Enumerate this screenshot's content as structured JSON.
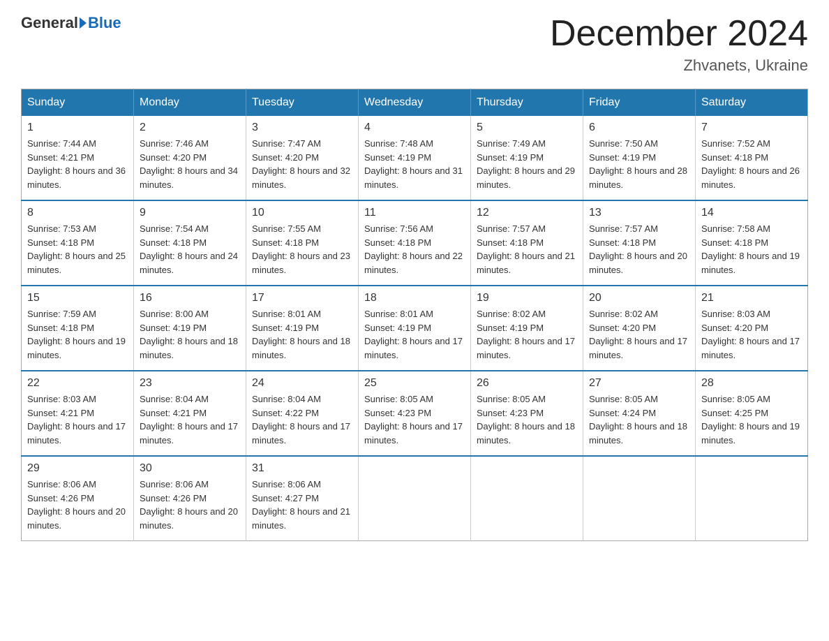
{
  "header": {
    "logo_general": "General",
    "logo_blue": "Blue",
    "month_title": "December 2024",
    "location": "Zhvanets, Ukraine"
  },
  "weekdays": [
    "Sunday",
    "Monday",
    "Tuesday",
    "Wednesday",
    "Thursday",
    "Friday",
    "Saturday"
  ],
  "weeks": [
    [
      {
        "day": "1",
        "sunrise": "Sunrise: 7:44 AM",
        "sunset": "Sunset: 4:21 PM",
        "daylight": "Daylight: 8 hours and 36 minutes."
      },
      {
        "day": "2",
        "sunrise": "Sunrise: 7:46 AM",
        "sunset": "Sunset: 4:20 PM",
        "daylight": "Daylight: 8 hours and 34 minutes."
      },
      {
        "day": "3",
        "sunrise": "Sunrise: 7:47 AM",
        "sunset": "Sunset: 4:20 PM",
        "daylight": "Daylight: 8 hours and 32 minutes."
      },
      {
        "day": "4",
        "sunrise": "Sunrise: 7:48 AM",
        "sunset": "Sunset: 4:19 PM",
        "daylight": "Daylight: 8 hours and 31 minutes."
      },
      {
        "day": "5",
        "sunrise": "Sunrise: 7:49 AM",
        "sunset": "Sunset: 4:19 PM",
        "daylight": "Daylight: 8 hours and 29 minutes."
      },
      {
        "day": "6",
        "sunrise": "Sunrise: 7:50 AM",
        "sunset": "Sunset: 4:19 PM",
        "daylight": "Daylight: 8 hours and 28 minutes."
      },
      {
        "day": "7",
        "sunrise": "Sunrise: 7:52 AM",
        "sunset": "Sunset: 4:18 PM",
        "daylight": "Daylight: 8 hours and 26 minutes."
      }
    ],
    [
      {
        "day": "8",
        "sunrise": "Sunrise: 7:53 AM",
        "sunset": "Sunset: 4:18 PM",
        "daylight": "Daylight: 8 hours and 25 minutes."
      },
      {
        "day": "9",
        "sunrise": "Sunrise: 7:54 AM",
        "sunset": "Sunset: 4:18 PM",
        "daylight": "Daylight: 8 hours and 24 minutes."
      },
      {
        "day": "10",
        "sunrise": "Sunrise: 7:55 AM",
        "sunset": "Sunset: 4:18 PM",
        "daylight": "Daylight: 8 hours and 23 minutes."
      },
      {
        "day": "11",
        "sunrise": "Sunrise: 7:56 AM",
        "sunset": "Sunset: 4:18 PM",
        "daylight": "Daylight: 8 hours and 22 minutes."
      },
      {
        "day": "12",
        "sunrise": "Sunrise: 7:57 AM",
        "sunset": "Sunset: 4:18 PM",
        "daylight": "Daylight: 8 hours and 21 minutes."
      },
      {
        "day": "13",
        "sunrise": "Sunrise: 7:57 AM",
        "sunset": "Sunset: 4:18 PM",
        "daylight": "Daylight: 8 hours and 20 minutes."
      },
      {
        "day": "14",
        "sunrise": "Sunrise: 7:58 AM",
        "sunset": "Sunset: 4:18 PM",
        "daylight": "Daylight: 8 hours and 19 minutes."
      }
    ],
    [
      {
        "day": "15",
        "sunrise": "Sunrise: 7:59 AM",
        "sunset": "Sunset: 4:18 PM",
        "daylight": "Daylight: 8 hours and 19 minutes."
      },
      {
        "day": "16",
        "sunrise": "Sunrise: 8:00 AM",
        "sunset": "Sunset: 4:19 PM",
        "daylight": "Daylight: 8 hours and 18 minutes."
      },
      {
        "day": "17",
        "sunrise": "Sunrise: 8:01 AM",
        "sunset": "Sunset: 4:19 PM",
        "daylight": "Daylight: 8 hours and 18 minutes."
      },
      {
        "day": "18",
        "sunrise": "Sunrise: 8:01 AM",
        "sunset": "Sunset: 4:19 PM",
        "daylight": "Daylight: 8 hours and 17 minutes."
      },
      {
        "day": "19",
        "sunrise": "Sunrise: 8:02 AM",
        "sunset": "Sunset: 4:19 PM",
        "daylight": "Daylight: 8 hours and 17 minutes."
      },
      {
        "day": "20",
        "sunrise": "Sunrise: 8:02 AM",
        "sunset": "Sunset: 4:20 PM",
        "daylight": "Daylight: 8 hours and 17 minutes."
      },
      {
        "day": "21",
        "sunrise": "Sunrise: 8:03 AM",
        "sunset": "Sunset: 4:20 PM",
        "daylight": "Daylight: 8 hours and 17 minutes."
      }
    ],
    [
      {
        "day": "22",
        "sunrise": "Sunrise: 8:03 AM",
        "sunset": "Sunset: 4:21 PM",
        "daylight": "Daylight: 8 hours and 17 minutes."
      },
      {
        "day": "23",
        "sunrise": "Sunrise: 8:04 AM",
        "sunset": "Sunset: 4:21 PM",
        "daylight": "Daylight: 8 hours and 17 minutes."
      },
      {
        "day": "24",
        "sunrise": "Sunrise: 8:04 AM",
        "sunset": "Sunset: 4:22 PM",
        "daylight": "Daylight: 8 hours and 17 minutes."
      },
      {
        "day": "25",
        "sunrise": "Sunrise: 8:05 AM",
        "sunset": "Sunset: 4:23 PM",
        "daylight": "Daylight: 8 hours and 17 minutes."
      },
      {
        "day": "26",
        "sunrise": "Sunrise: 8:05 AM",
        "sunset": "Sunset: 4:23 PM",
        "daylight": "Daylight: 8 hours and 18 minutes."
      },
      {
        "day": "27",
        "sunrise": "Sunrise: 8:05 AM",
        "sunset": "Sunset: 4:24 PM",
        "daylight": "Daylight: 8 hours and 18 minutes."
      },
      {
        "day": "28",
        "sunrise": "Sunrise: 8:05 AM",
        "sunset": "Sunset: 4:25 PM",
        "daylight": "Daylight: 8 hours and 19 minutes."
      }
    ],
    [
      {
        "day": "29",
        "sunrise": "Sunrise: 8:06 AM",
        "sunset": "Sunset: 4:26 PM",
        "daylight": "Daylight: 8 hours and 20 minutes."
      },
      {
        "day": "30",
        "sunrise": "Sunrise: 8:06 AM",
        "sunset": "Sunset: 4:26 PM",
        "daylight": "Daylight: 8 hours and 20 minutes."
      },
      {
        "day": "31",
        "sunrise": "Sunrise: 8:06 AM",
        "sunset": "Sunset: 4:27 PM",
        "daylight": "Daylight: 8 hours and 21 minutes."
      },
      null,
      null,
      null,
      null
    ]
  ]
}
